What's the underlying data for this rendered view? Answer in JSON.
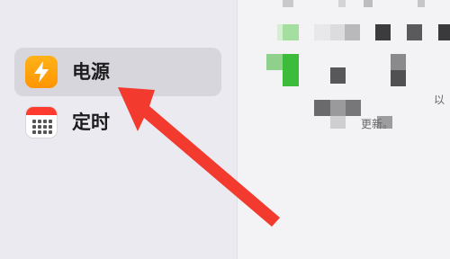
{
  "sidebar": {
    "items": [
      {
        "label": "电源",
        "icon": "power-lightning-icon",
        "selected": true,
        "icon_color": "#FF9F0A"
      },
      {
        "label": "定时",
        "icon": "calendar-schedule-icon",
        "selected": false,
        "icon_color": "#FF3B30"
      }
    ]
  },
  "main": {
    "partial_text_1": "以",
    "partial_text_2": "更新。"
  },
  "annotation": {
    "type": "red-arrow",
    "color": "#F23A2F",
    "target": "sidebar-item-power"
  },
  "colors": {
    "selection": "#D7D6DC",
    "sidebar_bg": "#EBEAF0",
    "main_bg": "#F3F3F5"
  }
}
